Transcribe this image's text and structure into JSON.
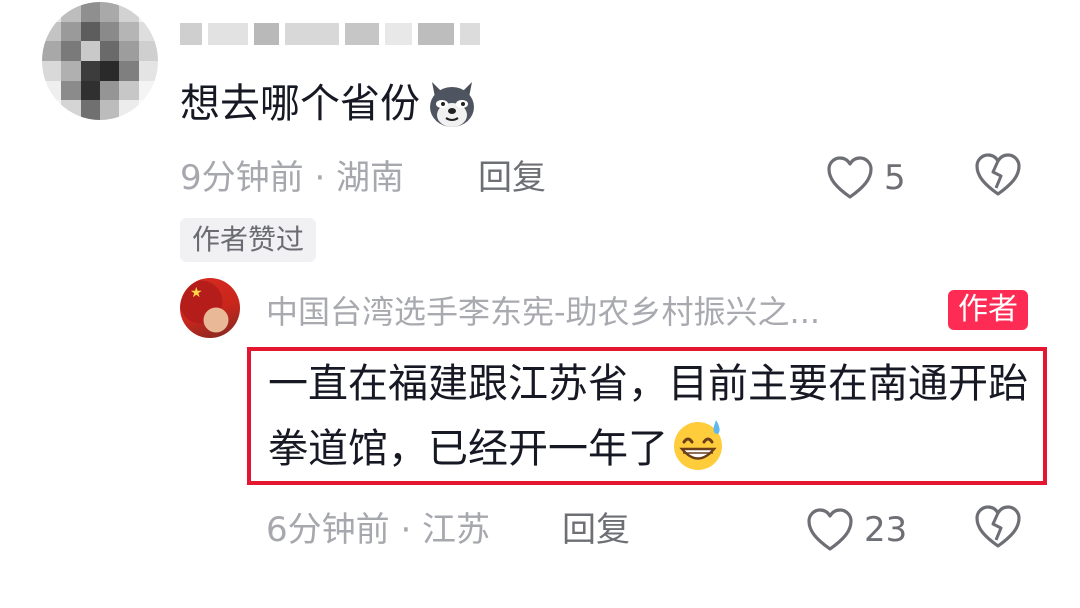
{
  "comment": {
    "text": "想去哪个省份",
    "emoji": "dog-face-emoji",
    "meta": "9分钟前 · 湖南",
    "reply_label": "回复",
    "like_count": "5",
    "badge": "作者赞过"
  },
  "reply": {
    "author_name": "中国台湾选手李东宪-助农乡村振兴之...",
    "author_badge": "作者",
    "text": "一直在福建跟江苏省，目前主要在南通开跆拳道馆，已经开一年了",
    "emoji": "grinning-sweat-emoji",
    "meta": "6分钟前 · 江苏",
    "reply_label": "回复",
    "like_count": "23"
  },
  "colors": {
    "accent": "#fe2c55",
    "highlight_border": "#e5162f",
    "meta_text": "#a6a8ad"
  }
}
